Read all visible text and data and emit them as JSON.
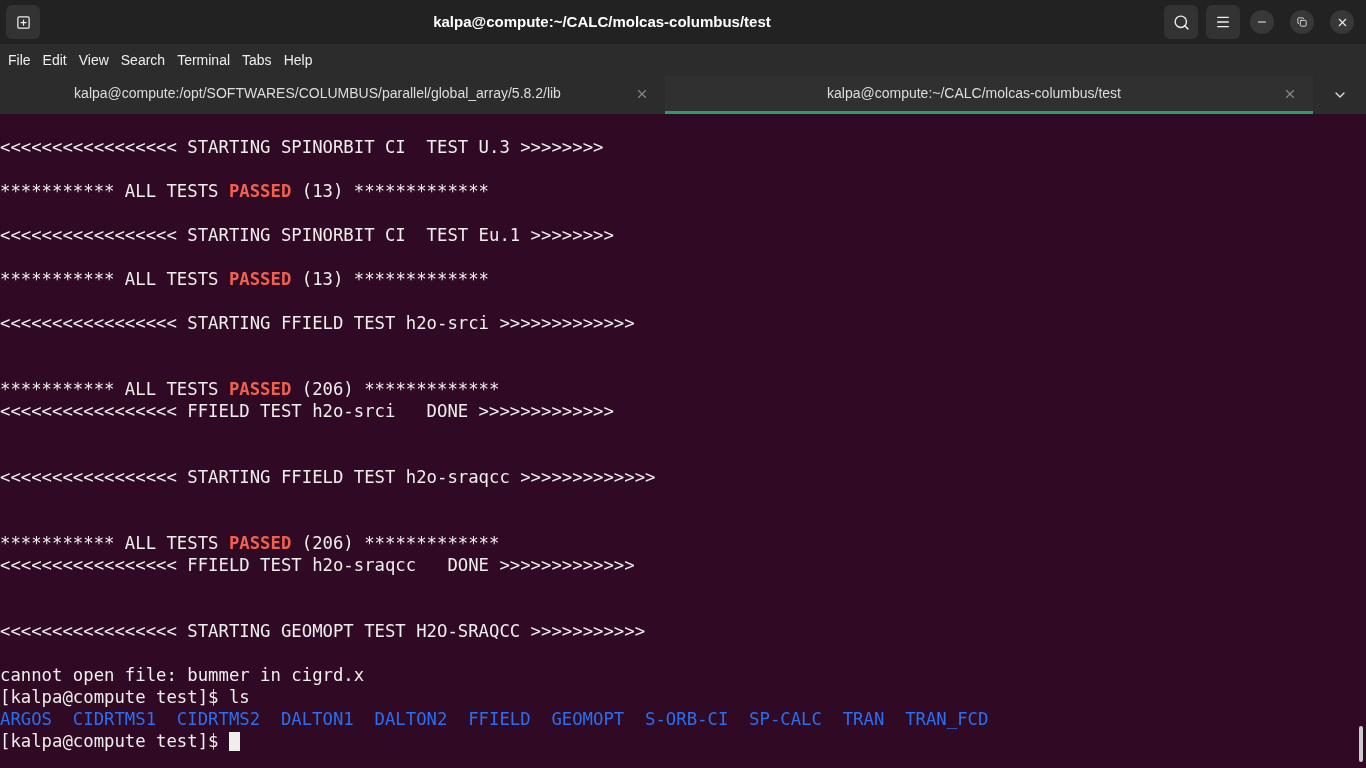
{
  "window": {
    "title": "kalpa@compute:~/CALC/molcas-columbus/test"
  },
  "menu": [
    "File",
    "Edit",
    "View",
    "Search",
    "Terminal",
    "Tabs",
    "Help"
  ],
  "tabs": [
    {
      "label": "kalpa@compute:/opt/SOFTWARES/COLUMBUS/parallel/global_array/5.8.2/lib",
      "selected": false
    },
    {
      "label": "kalpa@compute:~/CALC/molcas-columbus/test",
      "selected": true
    }
  ],
  "terminal": {
    "lines": [
      {
        "kind": "blank"
      },
      {
        "kind": "text",
        "segments": [
          {
            "text": "<<<<<<<<<<<<<<<<< STARTING SPINORBIT CI  TEST U.3 >>>>>>>>",
            "kind": "plain"
          }
        ]
      },
      {
        "kind": "blank"
      },
      {
        "kind": "text",
        "segments": [
          {
            "text": "*********** ALL TESTS ",
            "kind": "plain"
          },
          {
            "text": "PASSED",
            "kind": "passed"
          },
          {
            "text": " (13) *************",
            "kind": "plain"
          }
        ]
      },
      {
        "kind": "blank"
      },
      {
        "kind": "text",
        "segments": [
          {
            "text": "<<<<<<<<<<<<<<<<< STARTING SPINORBIT CI  TEST Eu.1 >>>>>>>>",
            "kind": "plain"
          }
        ]
      },
      {
        "kind": "blank"
      },
      {
        "kind": "text",
        "segments": [
          {
            "text": "*********** ALL TESTS ",
            "kind": "plain"
          },
          {
            "text": "PASSED",
            "kind": "passed"
          },
          {
            "text": " (13) *************",
            "kind": "plain"
          }
        ]
      },
      {
        "kind": "blank"
      },
      {
        "kind": "text",
        "segments": [
          {
            "text": "<<<<<<<<<<<<<<<<< STARTING FFIELD TEST h2o-srci >>>>>>>>>>>>>",
            "kind": "plain"
          }
        ]
      },
      {
        "kind": "blank"
      },
      {
        "kind": "blank"
      },
      {
        "kind": "text",
        "segments": [
          {
            "text": "*********** ALL TESTS ",
            "kind": "plain"
          },
          {
            "text": "PASSED",
            "kind": "passed"
          },
          {
            "text": " (206) *************",
            "kind": "plain"
          }
        ]
      },
      {
        "kind": "text",
        "segments": [
          {
            "text": "<<<<<<<<<<<<<<<<< FFIELD TEST h2o-srci   DONE >>>>>>>>>>>>>",
            "kind": "plain"
          }
        ]
      },
      {
        "kind": "blank"
      },
      {
        "kind": "blank"
      },
      {
        "kind": "text",
        "segments": [
          {
            "text": "<<<<<<<<<<<<<<<<< STARTING FFIELD TEST h2o-sraqcc >>>>>>>>>>>>>",
            "kind": "plain"
          }
        ]
      },
      {
        "kind": "blank"
      },
      {
        "kind": "blank"
      },
      {
        "kind": "text",
        "segments": [
          {
            "text": "*********** ALL TESTS ",
            "kind": "plain"
          },
          {
            "text": "PASSED",
            "kind": "passed"
          },
          {
            "text": " (206) *************",
            "kind": "plain"
          }
        ]
      },
      {
        "kind": "text",
        "segments": [
          {
            "text": "<<<<<<<<<<<<<<<<< FFIELD TEST h2o-sraqcc   DONE >>>>>>>>>>>>>",
            "kind": "plain"
          }
        ]
      },
      {
        "kind": "blank"
      },
      {
        "kind": "blank"
      },
      {
        "kind": "text",
        "segments": [
          {
            "text": "<<<<<<<<<<<<<<<<< STARTING GEOMOPT TEST H2O-SRAQCC >>>>>>>>>>>",
            "kind": "plain"
          }
        ]
      },
      {
        "kind": "blank"
      },
      {
        "kind": "text",
        "segments": [
          {
            "text": "cannot open file: bummer in cigrd.x",
            "kind": "plain"
          }
        ]
      },
      {
        "kind": "text",
        "segments": [
          {
            "text": "[kalpa@compute test]$ ls",
            "kind": "plain"
          }
        ]
      },
      {
        "kind": "listing",
        "items": [
          "ARGOS",
          "CIDRTMS1",
          "CIDRTMS2",
          "DALTON1",
          "DALTON2",
          "FFIELD",
          "GEOMOPT",
          "S-ORB-CI",
          "SP-CALC",
          "TRAN",
          "TRAN_FCD"
        ]
      },
      {
        "kind": "prompt",
        "text": "[kalpa@compute test]$ ",
        "cursor": true
      }
    ]
  }
}
